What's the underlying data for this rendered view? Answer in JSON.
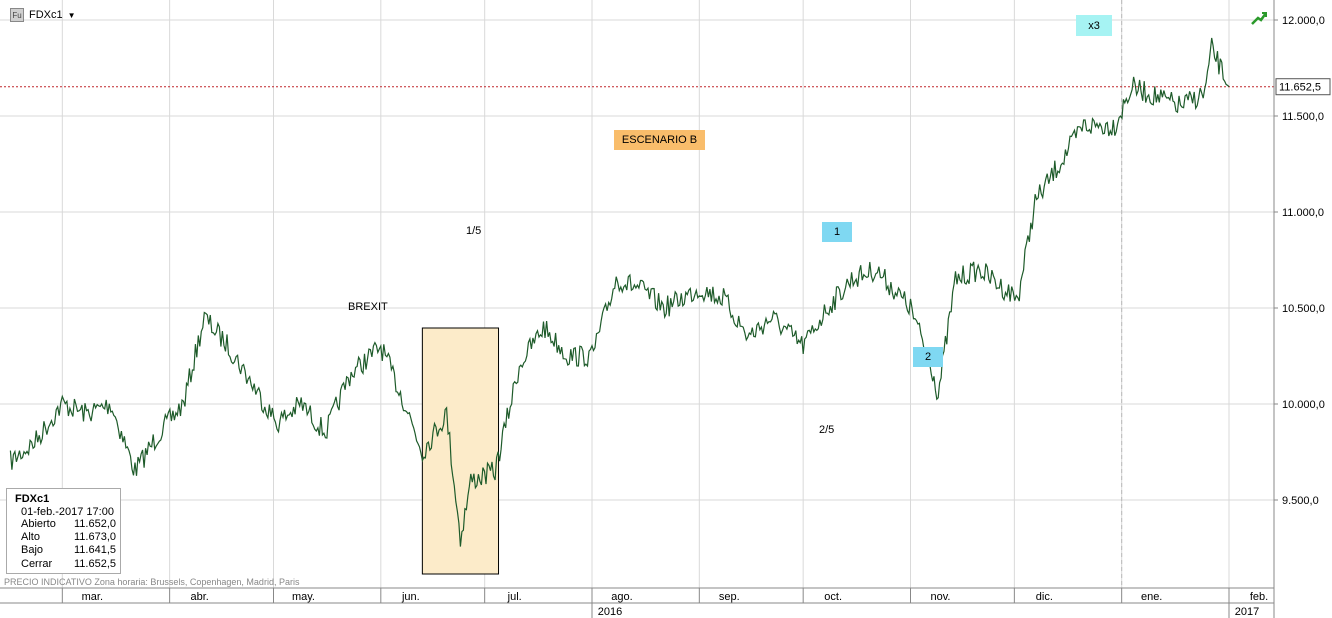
{
  "header": {
    "symbol": "FDXc1",
    "badge": "Fu"
  },
  "info": {
    "symbol": "FDXc1",
    "datetime": "01-feb.-2017 17:00",
    "rows": [
      {
        "label": "Abierto",
        "value": "11.652,0"
      },
      {
        "label": "Alto",
        "value": "11.673,0"
      },
      {
        "label": "Bajo",
        "value": "11.641,5"
      },
      {
        "label": "Cerrar",
        "value": "11.652,5"
      }
    ]
  },
  "footnote": "PRECIO INDICATIVO   Zona horaria: Brussels, Copenhagen, Madrid, Paris",
  "annotations": {
    "brexit": "BREXIT",
    "escenario": "ESCENARIO B",
    "one_fifth": "1/5",
    "two_fifth": "2/5",
    "one": "1",
    "two": "2",
    "x3": "x3"
  },
  "colors": {
    "line": "#1e5b2a",
    "brexit_fill": "#fcebc9",
    "escenario_fill": "#f9bd6b",
    "label_fill": "#7fd8f2",
    "x3_fill": "#a6f3f3",
    "last_price_line": "#c0262c",
    "grid": "#d9d9d9"
  },
  "chart_data": {
    "type": "line",
    "series": [
      {
        "x": [
          "2016-02-15",
          "2016-02-22",
          "2016-03-01",
          "2016-03-08",
          "2016-03-15",
          "2016-03-22",
          "2016-03-29",
          "2016-04-05",
          "2016-04-11",
          "2016-04-18",
          "2016-04-25",
          "2016-05-02",
          "2016-05-09",
          "2016-05-16",
          "2016-05-23",
          "2016-06-01",
          "2016-06-08",
          "2016-06-13",
          "2016-06-20",
          "2016-06-24",
          "2016-06-27",
          "2016-07-04",
          "2016-07-11",
          "2016-07-18",
          "2016-07-25",
          "2016-08-01",
          "2016-08-08",
          "2016-08-15",
          "2016-08-22",
          "2016-09-01",
          "2016-09-08",
          "2016-09-15",
          "2016-09-22",
          "2016-10-01",
          "2016-10-08",
          "2016-10-15",
          "2016-10-22",
          "2016-11-01",
          "2016-11-07",
          "2016-11-09",
          "2016-11-14",
          "2016-11-21",
          "2016-11-28",
          "2016-12-02",
          "2016-12-07",
          "2016-12-14",
          "2016-12-21",
          "2016-12-30",
          "2017-01-04",
          "2017-01-11",
          "2017-01-18",
          "2017-01-25",
          "2017-01-27",
          "2017-02-01"
        ],
        "values": [
          9700,
          9800,
          10000,
          9950,
          10000,
          9650,
          9850,
          10000,
          10450,
          10300,
          10100,
          9900,
          10000,
          9850,
          10150,
          10300,
          10000,
          9750,
          9950,
          9300,
          9600,
          9650,
          10200,
          10400,
          10250,
          10250,
          10650,
          10600,
          10500,
          10600,
          10550,
          10350,
          10450,
          10300,
          10500,
          10650,
          10700,
          10500,
          10200,
          10050,
          10650,
          10700,
          10600,
          10550,
          11050,
          11250,
          11450,
          11450,
          11650,
          11600,
          11550,
          11620,
          11850,
          11652.5
        ]
      }
    ],
    "last_price": 11652.5,
    "last_price_label": "11.652,5",
    "ylim": [
      9100,
      12100
    ],
    "y_ticks": [
      9500,
      10000,
      10500,
      11000,
      11500,
      12000
    ],
    "y_tick_labels": [
      "9.500,0",
      "10.000,0",
      "10.500,0",
      "11.000,0",
      "11.500,0",
      "12.000,0"
    ],
    "x_tick_labels": [
      {
        "date": "2016-03-01",
        "label": "mar."
      },
      {
        "date": "2016-04-01",
        "label": "abr."
      },
      {
        "date": "2016-05-01",
        "label": "may."
      },
      {
        "date": "2016-06-01",
        "label": "jun."
      },
      {
        "date": "2016-07-01",
        "label": "jul."
      },
      {
        "date": "2016-08-01",
        "label": "ago."
      },
      {
        "date": "2016-09-01",
        "label": "sep."
      },
      {
        "date": "2016-10-01",
        "label": "oct."
      },
      {
        "date": "2016-11-01",
        "label": "nov."
      },
      {
        "date": "2016-12-01",
        "label": "dic."
      },
      {
        "date": "2017-01-01",
        "label": "ene."
      },
      {
        "date": "2017-02-01",
        "label": "feb."
      }
    ],
    "year_labels": [
      {
        "date": "2016-08-01",
        "label": "2016"
      },
      {
        "date": "2017-02-01",
        "label": "2017"
      }
    ],
    "grid": true,
    "brexit_region": {
      "start": "2016-06-13",
      "end": "2016-07-05"
    }
  }
}
